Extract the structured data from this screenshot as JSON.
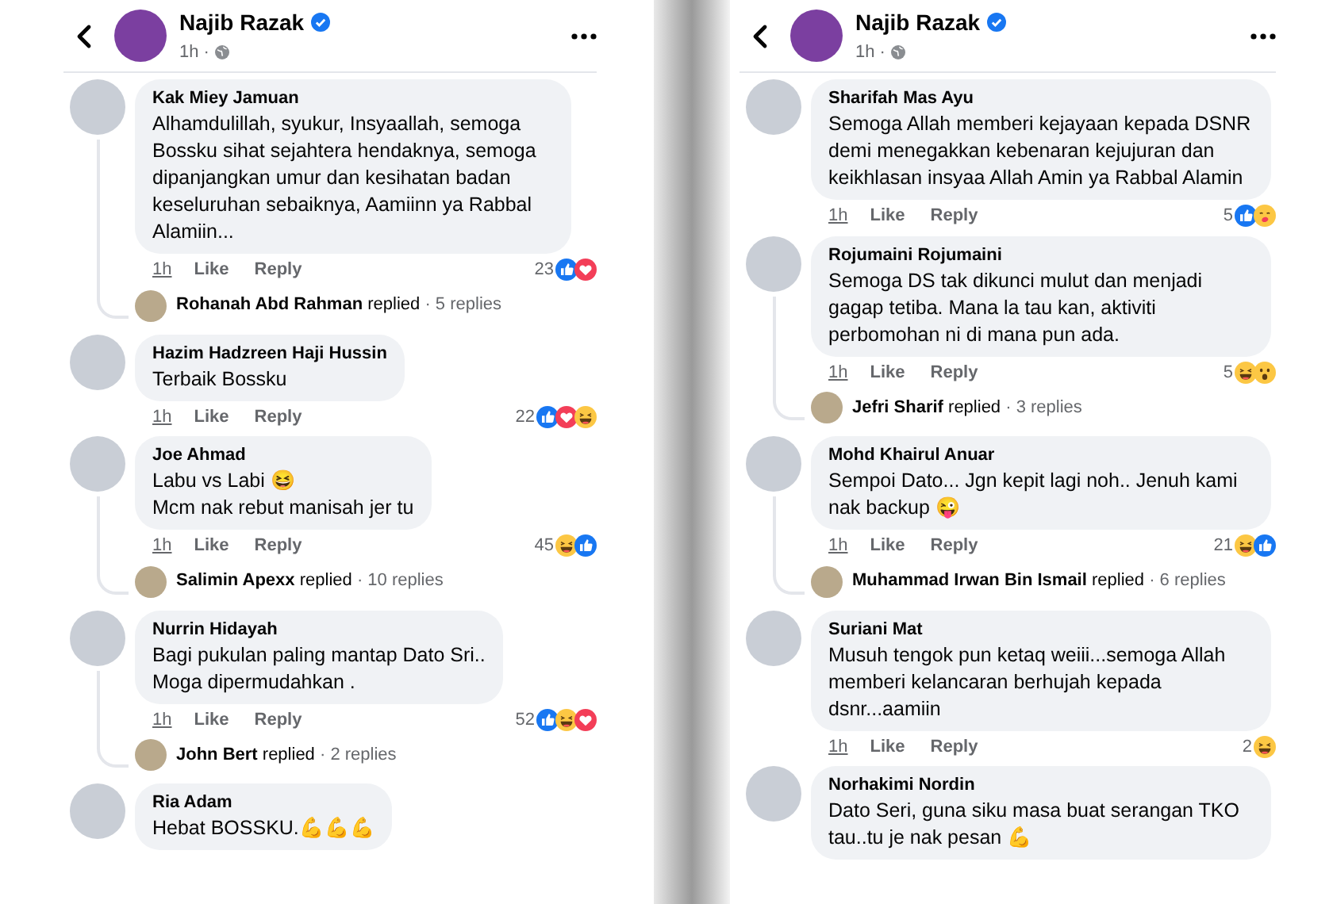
{
  "panels": [
    {
      "header": {
        "name": "Najib Razak",
        "time": "1h ·"
      },
      "comments": [
        {
          "author": "Kak Miey Jamuan",
          "text": "Alhamdulillah, syukur, Insyaallah, semoga Bossku sihat sejahtera hendaknya, semoga dipanjangkan umur dan kesihatan badan keseluruhan sebaiknya, Aamiinn ya Rabbal Alamiin...",
          "time": "1h",
          "like": "Like",
          "reply": "Reply",
          "count": "23",
          "reactions": [
            {
              "kind": "like"
            },
            {
              "kind": "love"
            }
          ],
          "replies": {
            "author": "Rohanah Abd Rahman",
            "verb": "replied",
            "count": "· 5 replies"
          }
        },
        {
          "author": "Hazim Hadzreen Haji Hussin",
          "text": "Terbaik Bossku",
          "time": "1h",
          "like": "Like",
          "reply": "Reply",
          "count": "22",
          "reactions": [
            {
              "kind": "like"
            },
            {
              "kind": "love"
            },
            {
              "kind": "haha"
            }
          ]
        },
        {
          "author": "Joe Ahmad",
          "text": "Labu vs Labi 😆\nMcm nak rebut manisah jer tu",
          "time": "1h",
          "like": "Like",
          "reply": "Reply",
          "count": "45",
          "reactions": [
            {
              "kind": "haha"
            },
            {
              "kind": "like"
            }
          ],
          "replies": {
            "author": "Salimin Apexx",
            "verb": "replied",
            "count": "· 10 replies"
          }
        },
        {
          "author": "Nurrin Hidayah",
          "text": "Bagi pukulan paling mantap Dato Sri..\nMoga dipermudahkan .",
          "time": "1h",
          "like": "Like",
          "reply": "Reply",
          "count": "52",
          "reactions": [
            {
              "kind": "like"
            },
            {
              "kind": "haha"
            },
            {
              "kind": "love"
            }
          ],
          "replies": {
            "author": "John Bert",
            "verb": "replied",
            "count": "· 2 replies"
          }
        },
        {
          "author": "Ria Adam",
          "text": "Hebat BOSSKU.💪💪💪"
        }
      ]
    },
    {
      "header": {
        "name": "Najib Razak",
        "time": "1h ·"
      },
      "comments": [
        {
          "author": "Sharifah Mas Ayu",
          "text": "Semoga Allah memberi kejayaan kepada DSNR demi menegakkan kebenaran kejujuran dan keikhlasan insyaa Allah Amin ya Rabbal Alamin",
          "time": "1h",
          "like": "Like",
          "reply": "Reply",
          "count": "5",
          "reactions": [
            {
              "kind": "like"
            },
            {
              "kind": "care"
            }
          ]
        },
        {
          "author": "Rojumaini Rojumaini",
          "text": "Semoga DS tak dikunci mulut dan menjadi gagap tetiba. Mana la tau kan, aktiviti perbomohan ni di mana pun ada.",
          "time": "1h",
          "like": "Like",
          "reply": "Reply",
          "count": "5",
          "reactions": [
            {
              "kind": "haha"
            },
            {
              "kind": "wow"
            }
          ],
          "replies": {
            "author": "Jefri Sharif",
            "verb": "replied",
            "count": "· 3 replies"
          }
        },
        {
          "author": "Mohd Khairul Anuar",
          "text": "Sempoi Dato... Jgn kepit lagi noh.. Jenuh kami nak backup 😜",
          "time": "1h",
          "like": "Like",
          "reply": "Reply",
          "count": "21",
          "reactions": [
            {
              "kind": "haha"
            },
            {
              "kind": "like"
            }
          ],
          "replies": {
            "author": "Muhammad Irwan Bin Ismail",
            "verb": "replied",
            "count": "· 6 replies"
          }
        },
        {
          "author": "Suriani Mat",
          "text": "Musuh tengok pun ketaq weiii...semoga Allah memberi kelancaran berhujah kepada dsnr...aamiin",
          "time": "1h",
          "like": "Like",
          "reply": "Reply",
          "count": "2",
          "reactions": [
            {
              "kind": "haha"
            }
          ]
        },
        {
          "author": "Norhakimi Nordin",
          "text": "Dato Seri, guna siku masa buat serangan TKO tau..tu je nak pesan 💪"
        }
      ]
    }
  ]
}
